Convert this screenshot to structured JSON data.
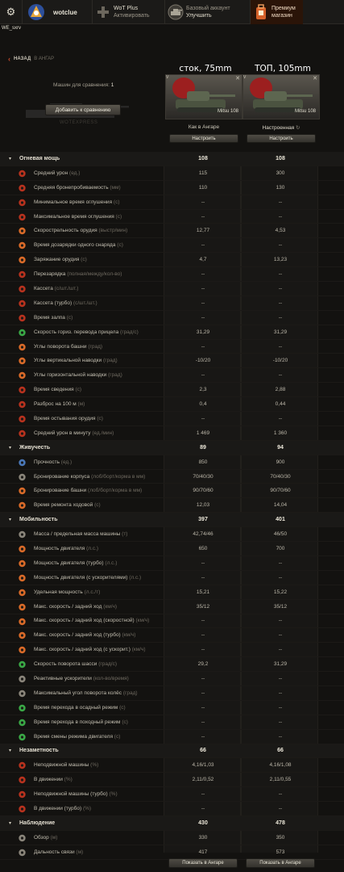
{
  "topbar": {
    "username": "wotclue",
    "wotplus": {
      "line1": "WoT Plus",
      "line2": "Активировать"
    },
    "account": {
      "line1": "Базовый аккаунт",
      "line2": "Улучшить"
    },
    "premium": {
      "line1": "Премиум",
      "line2": "магазин"
    }
  },
  "server": "WE_sxrv",
  "nav": {
    "back": "НАЗАД",
    "to": "В АНГАР"
  },
  "columns": {
    "stock": "сток, 75mm",
    "top": "ТОП, 105mm"
  },
  "compare": {
    "label": "Машин для сравнения:",
    "count": "1",
    "add_button": "Добавить к сравнению",
    "watermark": "WOTEXPRESS"
  },
  "cards": [
    {
      "flag": "V",
      "name": "Mitsu 108",
      "state": "Как в Ангаре",
      "configure": "Настроить"
    },
    {
      "flag": "V",
      "name": "Mitsu 108",
      "state": "Настроенная",
      "configure": "Настроить"
    }
  ],
  "rows": [
    {
      "section": true,
      "label": "Огневая мощь",
      "v1": "108",
      "v2": "108"
    },
    {
      "icon": "damage",
      "label": "Средний урон",
      "unit": "(ед.)",
      "v1": "115",
      "v2": "300"
    },
    {
      "icon": "penetration",
      "label": "Средняя бронепробиваемость",
      "unit": "(мм)",
      "v1": "110",
      "v2": "130"
    },
    {
      "icon": "stun",
      "label": "Минимальное время оглушения",
      "unit": "(с)",
      "v1": "--",
      "v2": "--"
    },
    {
      "icon": "stun",
      "label": "Максимальное время оглушения",
      "unit": "(с)",
      "v1": "--",
      "v2": "--"
    },
    {
      "icon": "rof",
      "label": "Скорострельность орудия",
      "unit": "(выстр/мин)",
      "v1": "12,77",
      "v2": "4,53"
    },
    {
      "icon": "shell",
      "label": "Время дозарядки одного снаряда",
      "unit": "(с)",
      "v1": "--",
      "v2": "--"
    },
    {
      "icon": "shell",
      "label": "Заряжание орудия",
      "unit": "(с)",
      "v1": "4,7",
      "v2": "13,23"
    },
    {
      "icon": "clip",
      "label": "Перезарядка",
      "unit": "(полная/между/кол-во)",
      "v1": "--",
      "v2": "--"
    },
    {
      "icon": "clip",
      "label": "Кассета",
      "unit": "(с/шт./шт.)",
      "v1": "--",
      "v2": "--"
    },
    {
      "icon": "clip",
      "label": "Кассета (турбо)",
      "unit": "(с/шт./шт.)",
      "v1": "--",
      "v2": "--"
    },
    {
      "icon": "clip",
      "label": "Время залпа",
      "unit": "(с)",
      "v1": "--",
      "v2": "--"
    },
    {
      "icon": "traverse",
      "label": "Скорость гориз. перевода прицела",
      "unit": "(град/с)",
      "v1": "31,29",
      "v2": "31,29"
    },
    {
      "icon": "turret",
      "label": "Углы поворота башни",
      "unit": "(град)",
      "v1": "--",
      "v2": "--"
    },
    {
      "icon": "elevation",
      "label": "Углы вертикальной наводки",
      "unit": "(град)",
      "v1": "-10/20",
      "v2": "-10/20"
    },
    {
      "icon": "elevation",
      "label": "Углы горизонтальной наводки",
      "unit": "(град)",
      "v1": "--",
      "v2": "--"
    },
    {
      "icon": "aim",
      "label": "Время сведения",
      "unit": "(с)",
      "v1": "2,3",
      "v2": "2,88"
    },
    {
      "icon": "aim",
      "label": "Разброс на 100 м",
      "unit": "(м)",
      "v1": "0,4",
      "v2": "0,44"
    },
    {
      "icon": "cool",
      "label": "Время остывания орудия",
      "unit": "(с)",
      "v1": "--",
      "v2": "--"
    },
    {
      "icon": "dpm",
      "label": "Средний урон в минуту",
      "unit": "(ед./мин)",
      "v1": "1 469",
      "v2": "1 360"
    },
    {
      "section": true,
      "label": "Живучесть",
      "v1": "89",
      "v2": "94"
    },
    {
      "icon": "hp",
      "label": "Прочность",
      "unit": "(ед.)",
      "v1": "850",
      "v2": "900"
    },
    {
      "icon": "hull",
      "label": "Бронирование корпуса",
      "unit": "(лоб/борт/корма в мм)",
      "v1": "70/40/30",
      "v2": "70/40/30"
    },
    {
      "icon": "turret",
      "label": "Бронирование башни",
      "unit": "(лоб/борт/корма в мм)",
      "v1": "90/70/60",
      "v2": "90/70/60"
    },
    {
      "icon": "repair",
      "label": "Время ремонта ходовой",
      "unit": "(с)",
      "v1": "12,03",
      "v2": "14,04"
    },
    {
      "section": true,
      "label": "Мобильность",
      "v1": "397",
      "v2": "401"
    },
    {
      "icon": "weight",
      "label": "Масса / предельная масса машины",
      "unit": "(т)",
      "v1": "42,74/46",
      "v2": "46/50"
    },
    {
      "icon": "engine",
      "label": "Мощность двигателя",
      "unit": "(л.с.)",
      "v1": "650",
      "v2": "700"
    },
    {
      "icon": "engine",
      "label": "Мощность двигателя (турбо)",
      "unit": "(л.с.)",
      "v1": "--",
      "v2": "--"
    },
    {
      "icon": "engine",
      "label": "Мощность двигателя (с ускорителями)",
      "unit": "(л.с.)",
      "v1": "--",
      "v2": "--"
    },
    {
      "icon": "power",
      "label": "Удельная мощность",
      "unit": "(л.с./т)",
      "v1": "15,21",
      "v2": "15,22"
    },
    {
      "icon": "speed",
      "label": "Макс. скорость / задний ход",
      "unit": "(км/ч)",
      "v1": "35/12",
      "v2": "35/12"
    },
    {
      "icon": "speed",
      "label": "Макс. скорость / задний ход (скоростной)",
      "unit": "(км/ч)",
      "v1": "--",
      "v2": "--"
    },
    {
      "icon": "speed",
      "label": "Макс. скорость / задний ход (турбо)",
      "unit": "(км/ч)",
      "v1": "--",
      "v2": "--"
    },
    {
      "icon": "speed",
      "label": "Макс. скорость / задний ход (с ускорит.)",
      "unit": "(км/ч)",
      "v1": "--",
      "v2": "--"
    },
    {
      "icon": "chassis",
      "label": "Скорость поворота шасси",
      "unit": "(град/с)",
      "v1": "29,2",
      "v2": "31,29"
    },
    {
      "icon": "boost",
      "label": "Реактивные ускорители",
      "unit": "(кол-во/время)",
      "v1": "--",
      "v2": "--"
    },
    {
      "icon": "wheel",
      "label": "Максимальный угол поворота колёс",
      "unit": "(град)",
      "v1": "--",
      "v2": "--"
    },
    {
      "icon": "mode",
      "label": "Время перехода в осадный режим",
      "unit": "(с)",
      "v1": "--",
      "v2": "--"
    },
    {
      "icon": "mode",
      "label": "Время перехода в походный режим",
      "unit": "(с)",
      "v1": "--",
      "v2": "--"
    },
    {
      "icon": "mode",
      "label": "Время смены режима двигателя",
      "unit": "(с)",
      "v1": "--",
      "v2": "--"
    },
    {
      "section": true,
      "label": "Незаметность",
      "v1": "66",
      "v2": "66"
    },
    {
      "icon": "camo",
      "label": "Неподвижной машины",
      "unit": "(%)",
      "v1": "4,16/1,03",
      "v2": "4,16/1,08"
    },
    {
      "icon": "camo",
      "label": "В движении",
      "unit": "(%)",
      "v1": "2,11/0,52",
      "v2": "2,11/0,55"
    },
    {
      "icon": "camo",
      "label": "Неподвижной машины (турбо)",
      "unit": "(%)",
      "v1": "--",
      "v2": "--"
    },
    {
      "icon": "camo",
      "label": "В движении (турбо)",
      "unit": "(%)",
      "v1": "--",
      "v2": "--"
    },
    {
      "section": true,
      "label": "Наблюдение",
      "v1": "430",
      "v2": "478"
    },
    {
      "icon": "view",
      "label": "Обзор",
      "unit": "(м)",
      "v1": "330",
      "v2": "350"
    },
    {
      "icon": "radio",
      "label": "Дальность связи",
      "unit": "(м)",
      "v1": "417",
      "v2": "573"
    }
  ],
  "footer": {
    "show1": "Показать в Ангаре",
    "show2": "Показать в Ангаре"
  },
  "colors": {
    "accent": "#c44a2c",
    "icon_red": "#b8321e",
    "icon_orange": "#d96a28",
    "icon_green": "#3aa846",
    "icon_blue": "#4a78b8",
    "icon_gray": "#8a857a"
  }
}
